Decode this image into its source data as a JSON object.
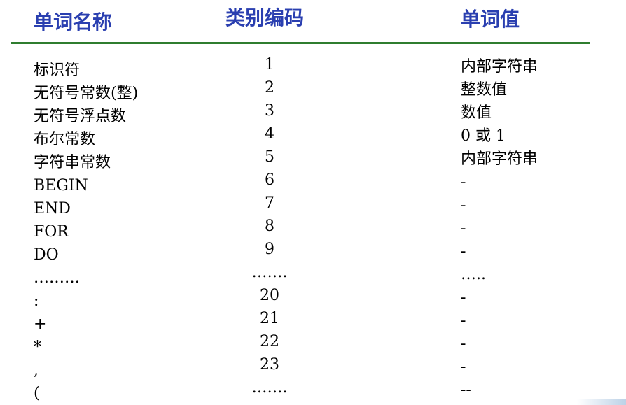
{
  "header": {
    "col_name": "单词名称",
    "col_code": "类别编码",
    "col_value": "单词值"
  },
  "rows": [
    {
      "name": "标识符",
      "code": "1",
      "value": "内部字符串"
    },
    {
      "name": "无符号常数(整)",
      "code": "2",
      "value": "整数值"
    },
    {
      "name": "无符号浮点数",
      "code": "3",
      "value": "数值"
    },
    {
      "name": "布尔常数",
      "code": "4",
      "value": "0 或 1"
    },
    {
      "name": "字符串常数",
      "code": "5",
      "value": "内部字符串"
    },
    {
      "name": "BEGIN",
      "code": "6",
      "value": "-"
    },
    {
      "name": "END",
      "code": "7",
      "value": "-"
    },
    {
      "name": "FOR",
      "code": "8",
      "value": "-"
    },
    {
      "name": "DO",
      "code": "9",
      "value": "-"
    },
    {
      "name": "………",
      "code": "…….",
      "value": "….."
    },
    {
      "name": ":",
      "code": "20",
      "value": "-"
    },
    {
      "name": "+",
      "code": "21",
      "value": "-"
    },
    {
      "name": "*",
      "code": "22",
      "value": "-"
    },
    {
      "name": ",",
      "code": "23",
      "value": "-"
    },
    {
      "name": "(",
      "code": "…….",
      "value": "--"
    }
  ],
  "colors": {
    "header_text": "#2a3fb0",
    "rule": "#2f7d2f"
  }
}
